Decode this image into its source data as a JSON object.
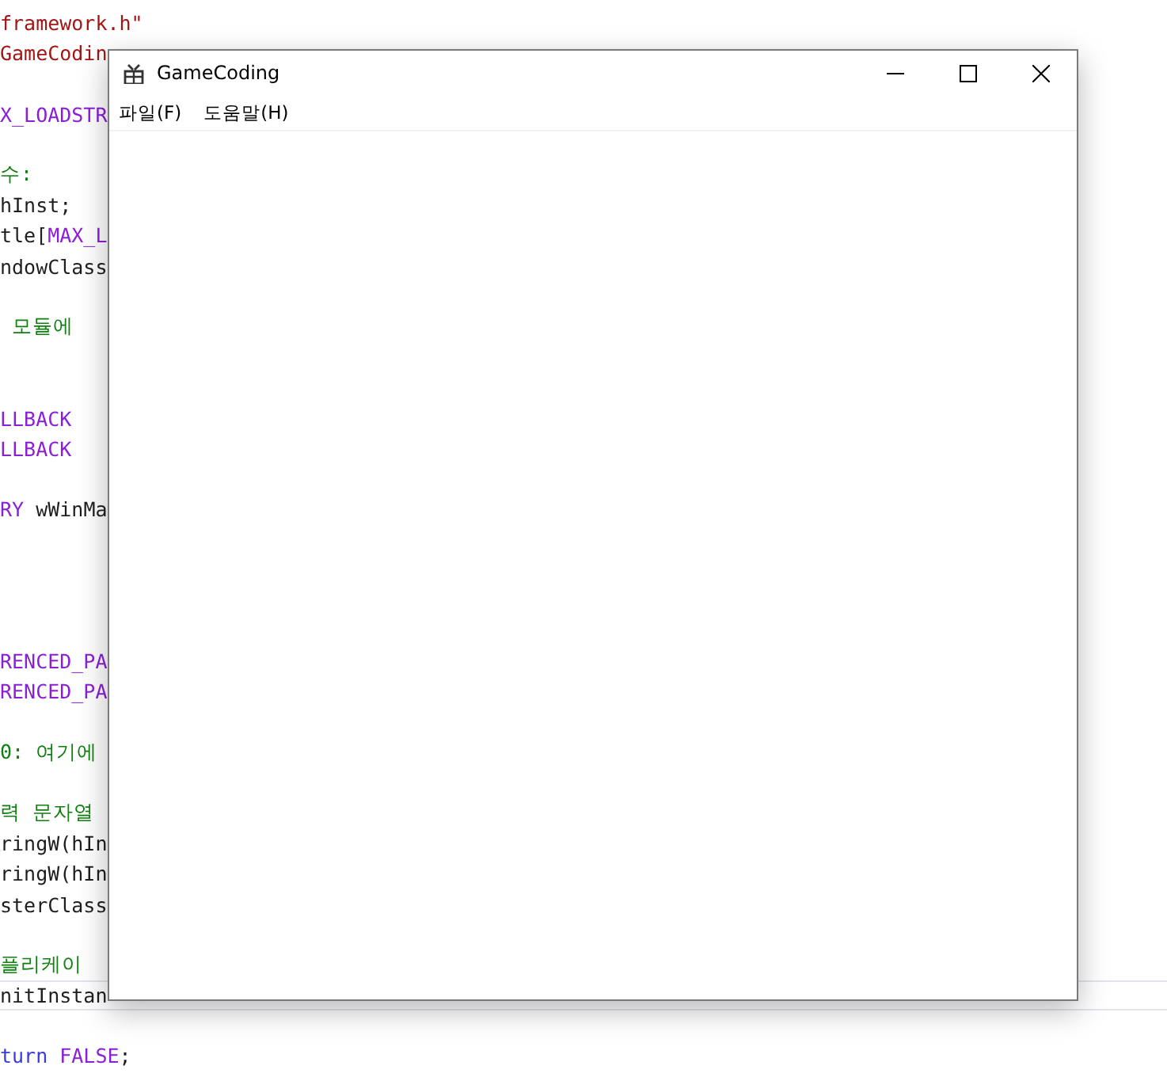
{
  "editor": {
    "lines": [
      {
        "kind": "code",
        "parts": [
          {
            "text": "framework.h\"",
            "kind": "string"
          }
        ]
      },
      {
        "kind": "code",
        "parts": [
          {
            "text": "GameCodin",
            "kind": "string"
          }
        ]
      },
      {
        "kind": "blank"
      },
      {
        "kind": "code",
        "parts": [
          {
            "text": "X_LOADSTR",
            "kind": "macro"
          }
        ]
      },
      {
        "kind": "blank"
      },
      {
        "kind": "code",
        "parts": [
          {
            "text": "수:",
            "kind": "comment"
          }
        ]
      },
      {
        "kind": "code",
        "parts": [
          {
            "text": "hInst;",
            "kind": "plain"
          }
        ]
      },
      {
        "kind": "code",
        "parts": [
          {
            "text": "tle[",
            "kind": "plain"
          },
          {
            "text": "MAX_L",
            "kind": "macro"
          }
        ]
      },
      {
        "kind": "code",
        "parts": [
          {
            "text": "ndowClass",
            "kind": "plain"
          }
        ]
      },
      {
        "kind": "blank"
      },
      {
        "kind": "code",
        "parts": [
          {
            "text": " 모듈에",
            "kind": "comment"
          }
        ]
      },
      {
        "kind": "blank"
      },
      {
        "kind": "blank"
      },
      {
        "kind": "code",
        "parts": [
          {
            "text": "LLBACK",
            "kind": "macro"
          }
        ]
      },
      {
        "kind": "code",
        "parts": [
          {
            "text": "LLBACK",
            "kind": "macro"
          }
        ]
      },
      {
        "kind": "blank"
      },
      {
        "kind": "code",
        "parts": [
          {
            "text": "RY",
            "kind": "macro"
          },
          {
            "text": " wWinMa",
            "kind": "plain"
          }
        ]
      },
      {
        "kind": "blank"
      },
      {
        "kind": "blank"
      },
      {
        "kind": "blank"
      },
      {
        "kind": "blank"
      },
      {
        "kind": "code",
        "parts": [
          {
            "text": "RENCED_PA",
            "kind": "macro"
          }
        ]
      },
      {
        "kind": "code",
        "parts": [
          {
            "text": "RENCED_PA",
            "kind": "macro"
          }
        ]
      },
      {
        "kind": "blank"
      },
      {
        "kind": "code",
        "parts": [
          {
            "text": "0: 여기에",
            "kind": "comment"
          }
        ]
      },
      {
        "kind": "blank"
      },
      {
        "kind": "code",
        "parts": [
          {
            "text": "력 문자열",
            "kind": "comment"
          }
        ]
      },
      {
        "kind": "code",
        "parts": [
          {
            "text": "ringW(hIn",
            "kind": "plain"
          }
        ]
      },
      {
        "kind": "code",
        "parts": [
          {
            "text": "ringW(hIn",
            "kind": "plain"
          }
        ]
      },
      {
        "kind": "code",
        "parts": [
          {
            "text": "sterClass",
            "kind": "plain"
          }
        ]
      },
      {
        "kind": "blank"
      },
      {
        "kind": "code",
        "parts": [
          {
            "text": "플리케이",
            "kind": "comment"
          }
        ]
      },
      {
        "kind": "code",
        "parts": [
          {
            "text": "nitInstan",
            "kind": "plain"
          }
        ],
        "current": true
      },
      {
        "kind": "blank"
      },
      {
        "kind": "code",
        "parts": [
          {
            "text": "turn",
            "kind": "keyword"
          },
          {
            "text": " FALSE",
            "kind": "macro"
          },
          {
            "text": ";",
            "kind": "plain"
          }
        ]
      }
    ]
  },
  "window": {
    "title": "GameCoding",
    "menu": [
      "파일(F)",
      "도움말(H)"
    ]
  }
}
